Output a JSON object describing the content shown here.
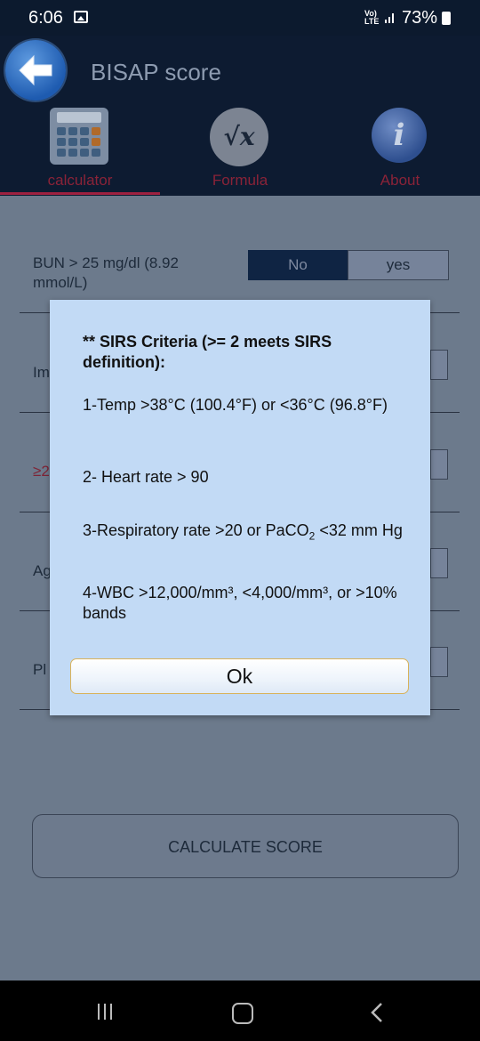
{
  "status_bar": {
    "time": "6:06",
    "network": "Vo) LTE",
    "battery_pct": "73%"
  },
  "header": {
    "title": "BISAP score"
  },
  "tabs": [
    {
      "label": "calculator",
      "active": true,
      "icon": "calculator-icon"
    },
    {
      "label": "Formula",
      "active": false,
      "icon": "formula-icon"
    },
    {
      "label": "About",
      "active": false,
      "icon": "info-icon"
    }
  ],
  "form": {
    "bun_label": "BUN > 25 mg/dl (8.92 mmol/L)",
    "bun_no": "No",
    "bun_yes": "yes",
    "row2_label_partial": "Im",
    "row3_label_partial": "≥2",
    "row4_label_partial": "Ag",
    "row5_label_partial": "Pl",
    "calculate_label": "CALCULATE SCORE"
  },
  "dialog": {
    "title": "** SIRS Criteria (>= 2 meets SIRS definition):",
    "item1": "1-Temp >38°C (100.4°F) or <36°C (96.8°F)",
    "item2": "2- Heart rate > 90",
    "item3_pre": "3-Respiratory rate >20 or PaCO",
    "item3_sub": "2",
    "item3_post": " <32 mm Hg",
    "item4": "4-WBC >12,000/mm³, <4,000/mm³, or >10% bands",
    "ok_label": "Ok"
  },
  "colors": {
    "header_bg": "#0d1b31",
    "dialog_bg": "#c2daf5",
    "accent_red": "#9e2140"
  }
}
